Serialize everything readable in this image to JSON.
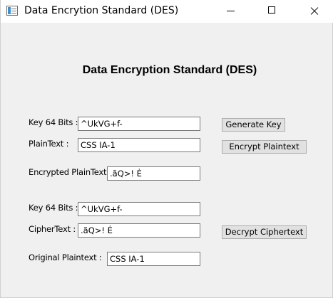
{
  "window": {
    "title": "Data Encrytion Standard (DES)"
  },
  "heading": "Data Encryption Standard (DES)",
  "encrypt_section": {
    "key_label": "Key 64 Bits :",
    "key_value": "^UkVG+f-",
    "plaintext_label": "PlainText :",
    "plaintext_value": "CSS IA-1",
    "encrypted_label": "Encrypted PlainText",
    "encrypted_value": ".ãQ>! Ė",
    "generate_key_button": "Generate Key",
    "encrypt_button": "Encrypt Plaintext"
  },
  "decrypt_section": {
    "key_label": "Key 64 Bits :",
    "key_value": "^UkVG+f-",
    "ciphertext_label": "CipherText :",
    "ciphertext_value": ".ãQ>! Ė",
    "original_label": "Original Plaintext :",
    "original_value": "CSS IA-1",
    "decrypt_button": "Decrypt Ciphertext"
  }
}
